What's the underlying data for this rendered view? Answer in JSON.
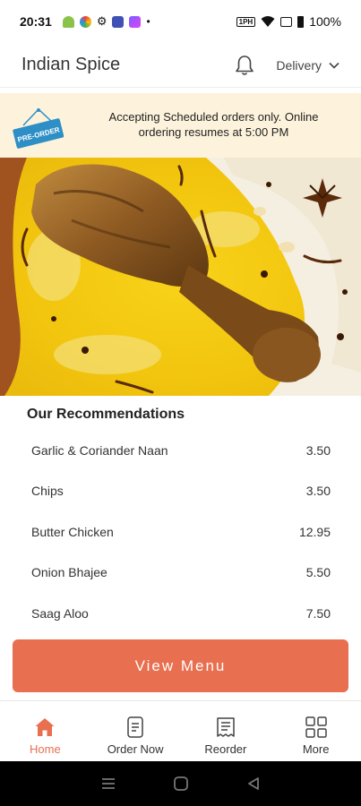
{
  "status_bar": {
    "time": "20:31",
    "battery": "100%",
    "speed_label": "1PH",
    "dot": "•"
  },
  "header": {
    "title": "Indian Spice",
    "mode": "Delivery"
  },
  "banner": {
    "badge": "PRE-ORDER",
    "message": "Accepting Scheduled orders only. Online ordering resumes at 5:00 PM"
  },
  "recommendations": {
    "title": "Our Recommendations",
    "items": [
      {
        "name": "Garlic & Coriander Naan",
        "price": "3.50"
      },
      {
        "name": "Chips",
        "price": "3.50"
      },
      {
        "name": "Butter Chicken",
        "price": "12.95"
      },
      {
        "name": "Onion Bhajee",
        "price": "5.50"
      },
      {
        "name": "Saag Aloo",
        "price": "7.50"
      }
    ]
  },
  "view_menu_label": "View Menu",
  "bottom_nav": [
    {
      "label": "Home",
      "icon": "home-icon",
      "active": true
    },
    {
      "label": "Order Now",
      "icon": "order-icon",
      "active": false
    },
    {
      "label": "Reorder",
      "icon": "receipt-icon",
      "active": false
    },
    {
      "label": "More",
      "icon": "grid-icon",
      "active": false
    }
  ],
  "colors": {
    "accent": "#e86f4f",
    "banner_bg": "#fdf3dc",
    "badge": "#2d8fc5"
  }
}
